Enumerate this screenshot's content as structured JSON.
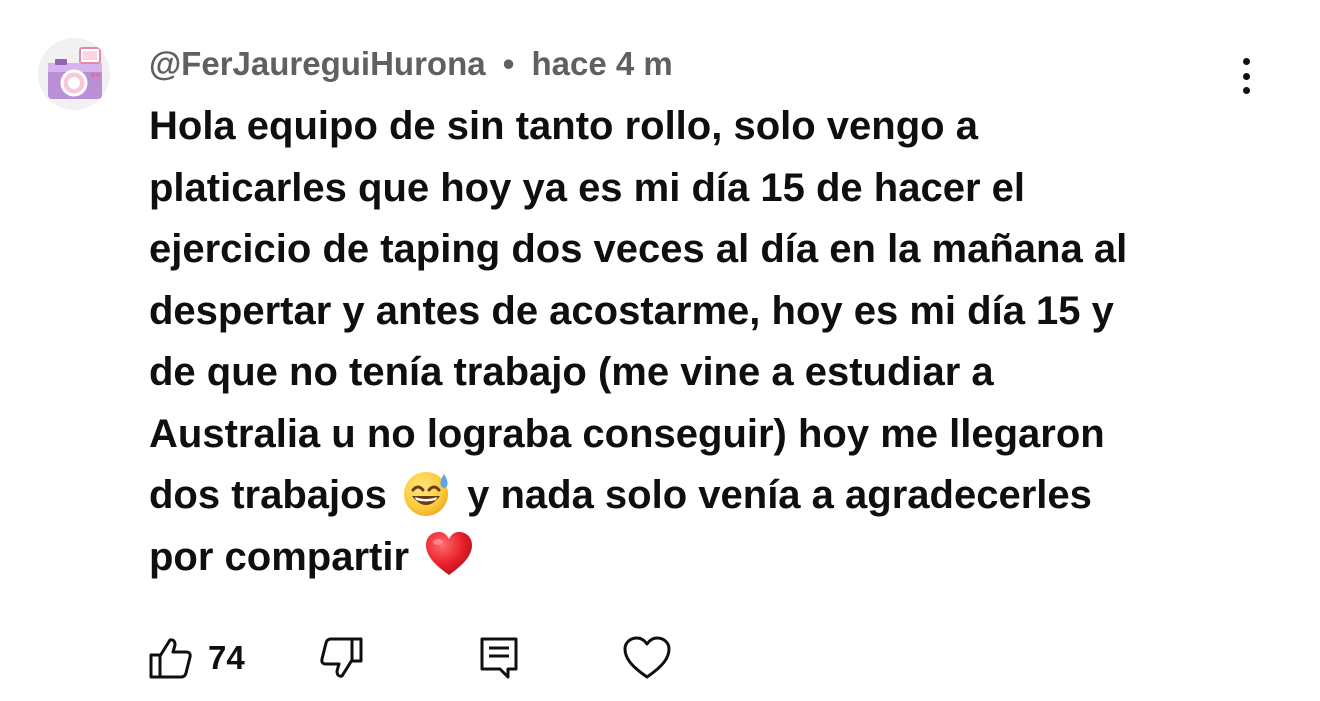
{
  "comment": {
    "author": "@FerJaureguiHurona",
    "separator": "•",
    "time": "hace 4 m",
    "lines": [
      "Hola equipo de sin tanto rollo, solo vengo a",
      "platicarles que hoy ya es mi día 15 de hacer el",
      "ejercicio de taping dos veces al día en la mañana al",
      "despertar y antes de acostarme, hoy es mi día 15 y",
      "de que no tenía trabajo (me vine a estudiar a",
      "Australia u no lograba conseguir) hoy me llegaron"
    ],
    "line7_before_emoji": "dos trabajos",
    "line7_after_emoji": "y nada solo venía a agradecerles",
    "line8_before_emoji": "por compartir",
    "emojis": {
      "sweat_smile": "sweat-smile-emoji",
      "heart": "red-heart-emoji"
    },
    "likes": "74"
  },
  "icons": {
    "avatar": "camera-avatar",
    "more": "more-vertical-icon",
    "like": "thumbs-up-icon",
    "dislike": "thumbs-down-icon",
    "reply": "reply-comment-icon",
    "heart": "heart-icon"
  }
}
